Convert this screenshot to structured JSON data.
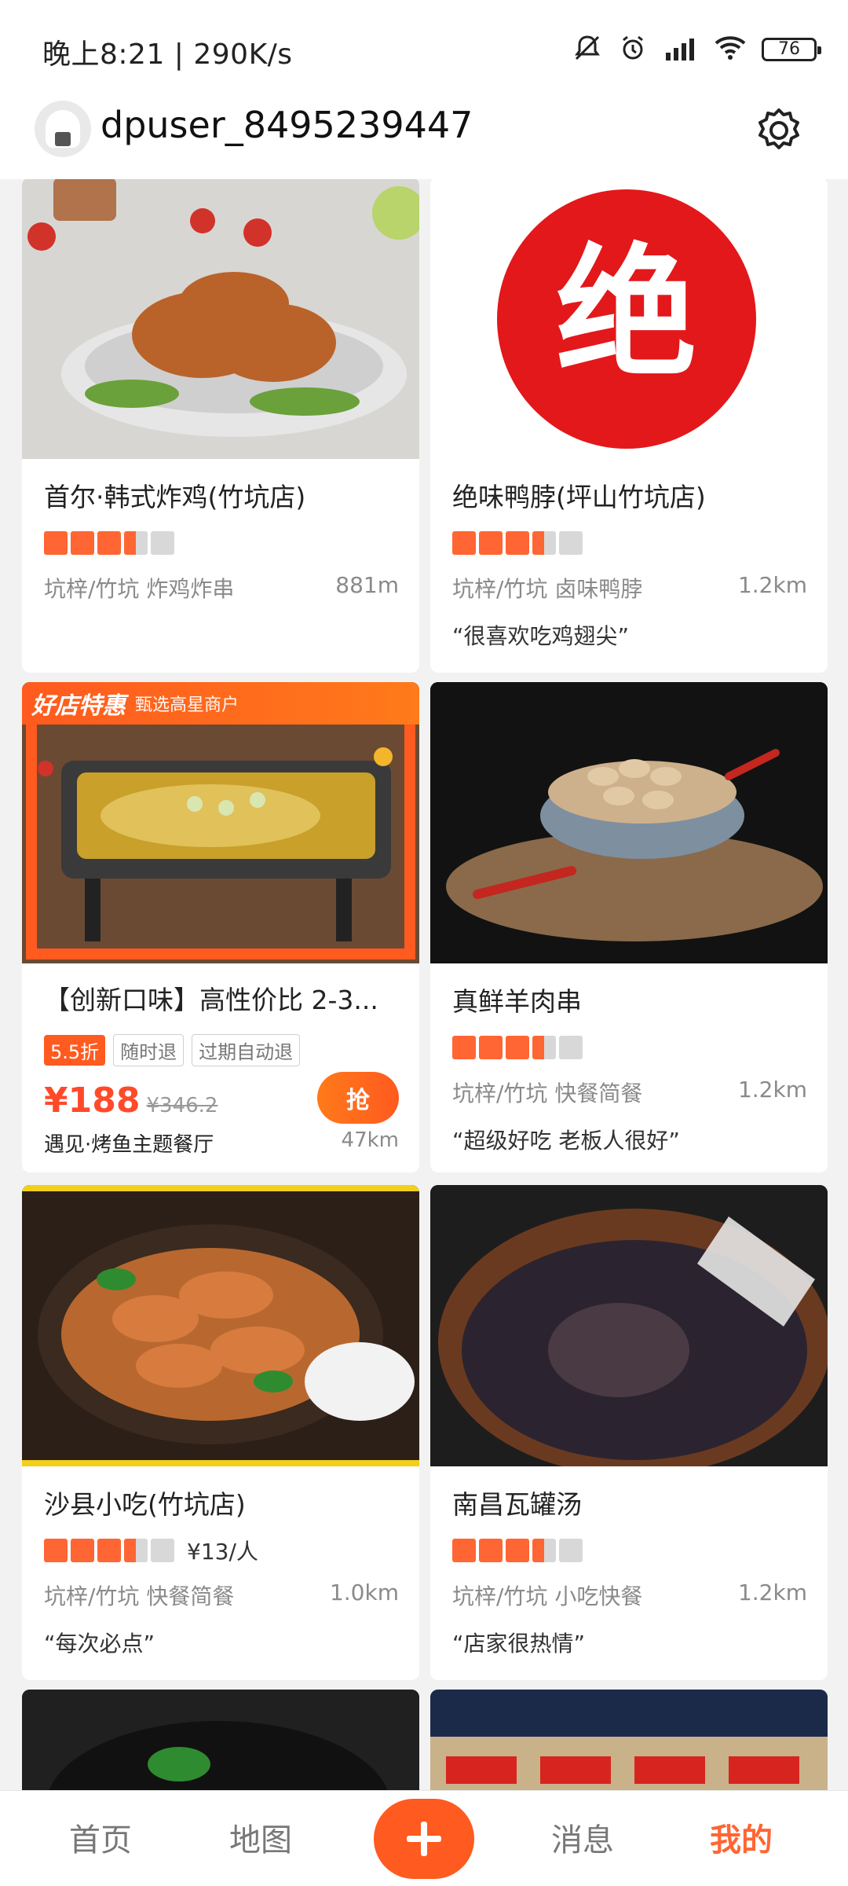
{
  "status": {
    "time": "晚上8:21 | 290K/s",
    "battery": "76"
  },
  "header": {
    "username": "dpuser_8495239447"
  },
  "cards": [
    {
      "title": "首尔·韩式炸鸡(竹坑店)",
      "rating": 3.5,
      "area": "坑梓/竹坑 炸鸡炸串",
      "distance": "881m"
    },
    {
      "title": "绝味鸭脖(坪山竹坑店)",
      "rating": 3.5,
      "area": "坑梓/竹坑 卤味鸭脖",
      "distance": "1.2km",
      "quote": "“很喜欢吃鸡翅尖”",
      "logo_text": "绝"
    },
    {
      "title": "【创新口味】高性价比 2-3...",
      "banner_title": "好店特惠",
      "banner_sub": "甄选高星商户",
      "discount": "5.5折",
      "tags": [
        "随时退",
        "过期自动退"
      ],
      "price_now": "¥188",
      "price_old": "¥346.2",
      "buy_label": "抢",
      "shop": "遇见·烤鱼主题餐厅",
      "distance": "47km"
    },
    {
      "title": "真鲜羊肉串",
      "rating": 3.5,
      "area": "坑梓/竹坑 快餐简餐",
      "distance": "1.2km",
      "quote": "“超级好吃 老板人很好”"
    },
    {
      "title": "沙县小吃(竹坑店)",
      "rating": 3.5,
      "price_per_person": "¥13/人",
      "area": "坑梓/竹坑 快餐简餐",
      "distance": "1.0km",
      "quote": "“每次必点”"
    },
    {
      "title": "南昌瓦罐汤",
      "rating": 3.5,
      "area": "坑梓/竹坑 小吃快餐",
      "distance": "1.2km",
      "quote": "“店家很热情”"
    }
  ],
  "bottom_nav": {
    "home": "首页",
    "map": "地图",
    "messages": "消息",
    "mine": "我的"
  },
  "colors": {
    "accent": "#ff6633",
    "brand_orange": "#ff5a1f",
    "price_red": "#ff4a2a"
  }
}
